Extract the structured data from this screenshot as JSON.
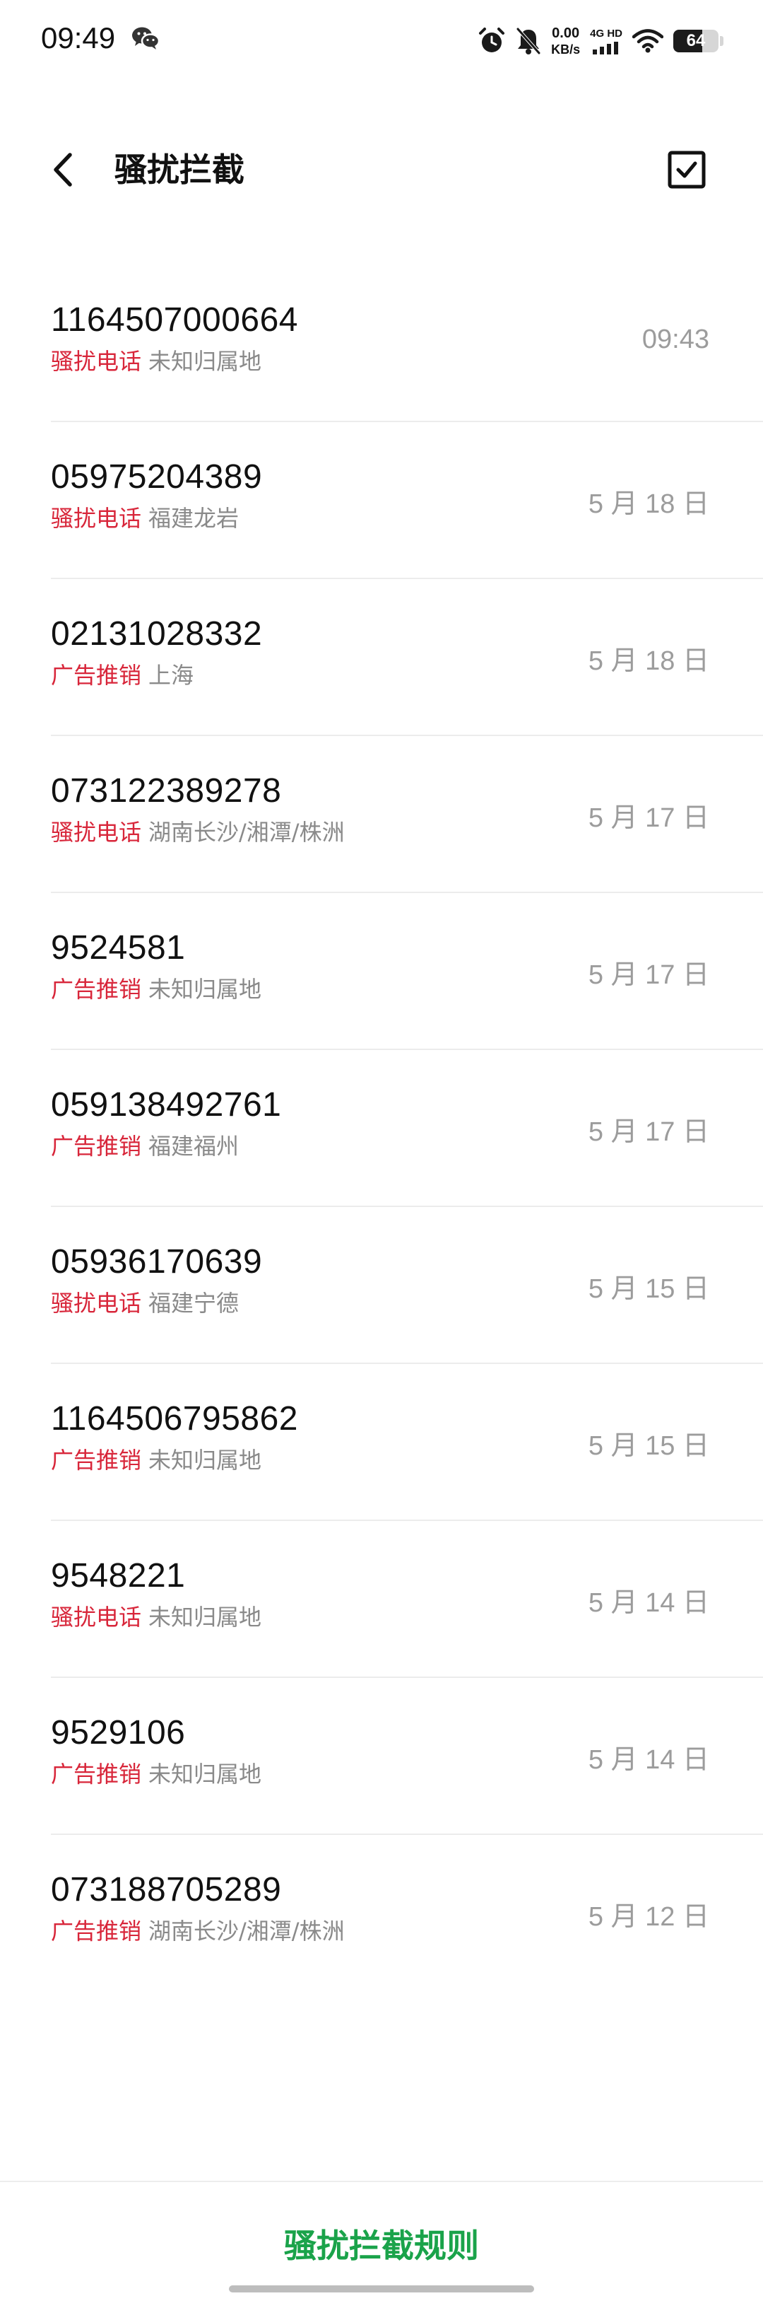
{
  "status_bar": {
    "time": "09:49",
    "net_speed_value": "0.00",
    "net_speed_unit": "KB/s",
    "network_label": "4G HD",
    "battery_level": "64",
    "battery_fraction": 0.64
  },
  "header": {
    "title": "骚扰拦截"
  },
  "calls": [
    {
      "number": "1164507000664",
      "tag": "骚扰电话",
      "location": "未知归属地",
      "date": "09:43"
    },
    {
      "number": "05975204389",
      "tag": "骚扰电话",
      "location": "福建龙岩",
      "date": "5 月 18 日"
    },
    {
      "number": "02131028332",
      "tag": "广告推销",
      "location": "上海",
      "date": "5 月 18 日"
    },
    {
      "number": "073122389278",
      "tag": "骚扰电话",
      "location": "湖南长沙/湘潭/株洲",
      "date": "5 月 17 日"
    },
    {
      "number": "9524581",
      "tag": "广告推销",
      "location": "未知归属地",
      "date": "5 月 17 日"
    },
    {
      "number": "059138492761",
      "tag": "广告推销",
      "location": "福建福州",
      "date": "5 月 17 日"
    },
    {
      "number": "05936170639",
      "tag": "骚扰电话",
      "location": "福建宁德",
      "date": "5 月 15 日"
    },
    {
      "number": "1164506795862",
      "tag": "广告推销",
      "location": "未知归属地",
      "date": "5 月 15 日"
    },
    {
      "number": "9548221",
      "tag": "骚扰电话",
      "location": "未知归属地",
      "date": "5 月 14 日"
    },
    {
      "number": "9529106",
      "tag": "广告推销",
      "location": "未知归属地",
      "date": "5 月 14 日"
    },
    {
      "number": "073188705289",
      "tag": "广告推销",
      "location": "湖南长沙/湘潭/株洲",
      "date": "5 月 12 日"
    }
  ],
  "footer": {
    "rules_label": "骚扰拦截规则"
  },
  "colors": {
    "tag_red": "#d8263a",
    "accent_green": "#1aa34a",
    "secondary_text": "#8a8a8a"
  },
  "icons": {
    "back": "chevron-left-icon",
    "select": "checkbox-checked-icon",
    "wechat": "wechat-icon",
    "alarm": "alarm-icon",
    "mute": "bell-off-icon",
    "signal": "signal-icon",
    "wifi": "wifi-icon",
    "battery": "battery-icon"
  }
}
